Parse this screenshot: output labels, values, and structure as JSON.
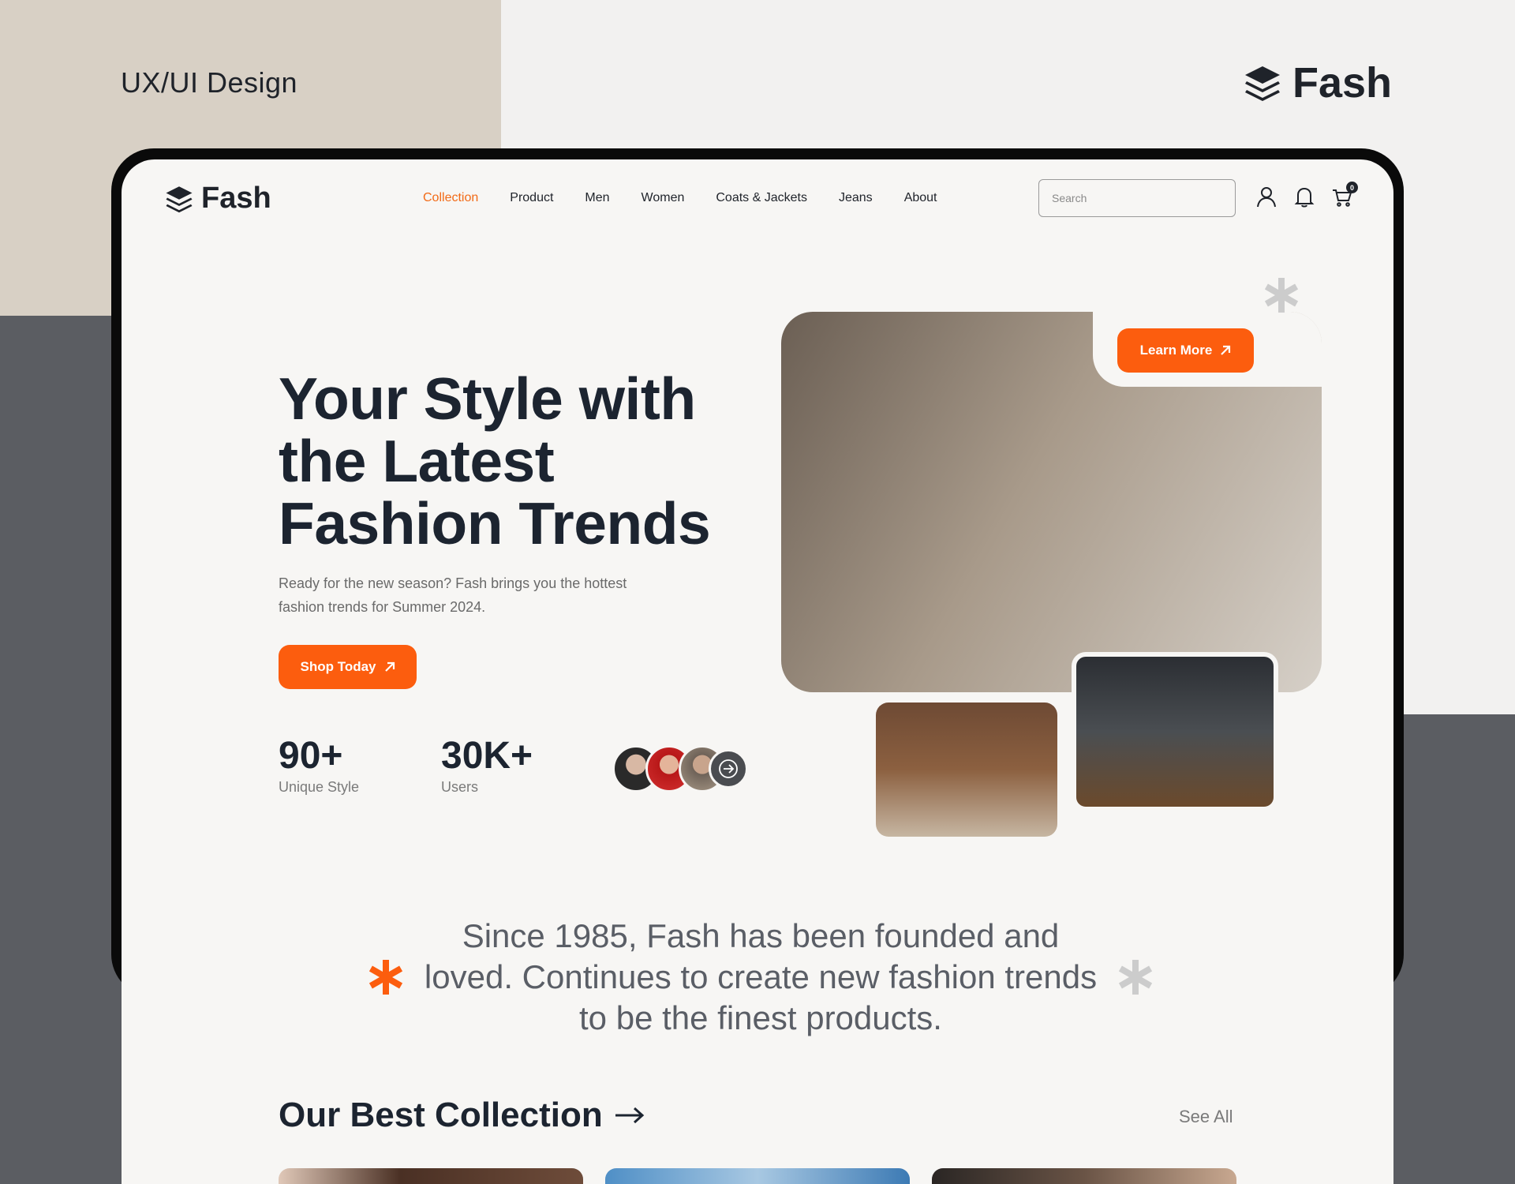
{
  "presentation": {
    "left_label": "UX/UI Design",
    "brand_name": "Fash"
  },
  "header": {
    "logo_text": "Fash",
    "nav": [
      "Collection",
      "Product",
      "Men",
      "Women",
      "Coats & Jackets",
      "Jeans",
      "About"
    ],
    "active_nav": "Collection",
    "search_placeholder": "Search",
    "cart_count": "0"
  },
  "hero": {
    "title": "Your Style with the Latest Fashion Trends",
    "subtitle": "Ready for the new season? Fash brings you the hottest fashion trends for Summer 2024.",
    "cta_label": "Shop Today",
    "learn_more_label": "Learn More",
    "stats": [
      {
        "value": "90+",
        "label": "Unique Style"
      },
      {
        "value": "30K+",
        "label": "Users"
      }
    ]
  },
  "about": {
    "quote": "Since 1985, Fash has been founded and loved. Continues to create new fashion trends to be the finest products."
  },
  "collection": {
    "title": "Our Best Collection",
    "see_all_label": "See All"
  },
  "colors": {
    "accent": "#fc5d0e",
    "dark": "#1c2430",
    "background": "#f7f6f4"
  }
}
